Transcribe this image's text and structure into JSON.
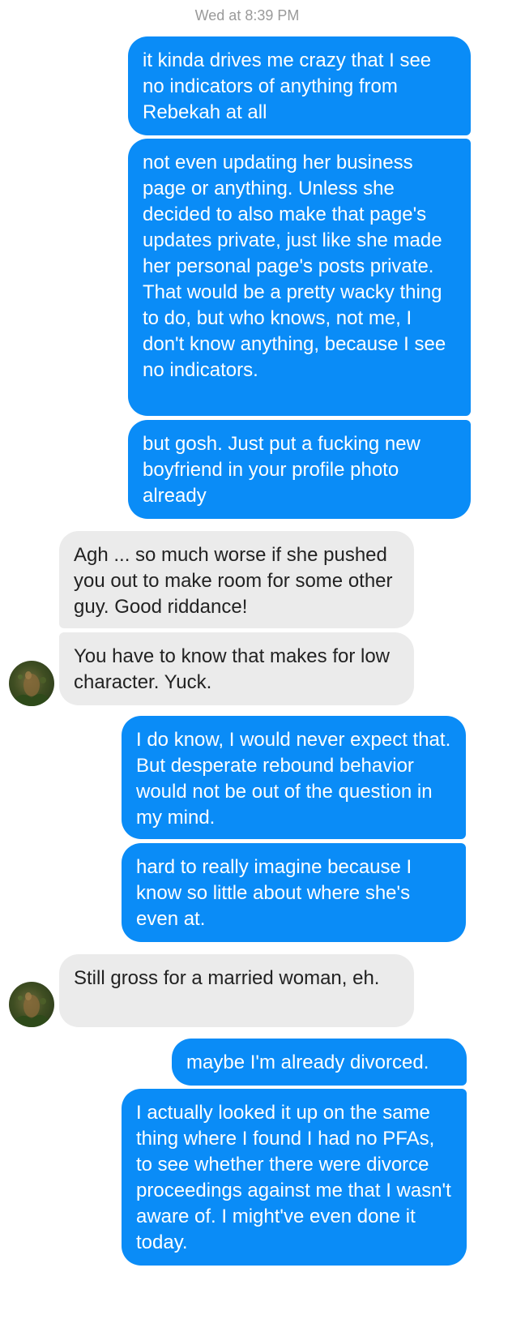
{
  "timestamp": "Wed at 8:39 PM",
  "messages": [
    {
      "direction": "outgoing",
      "text": "it kinda drives me crazy that I see no indicators of anything from Rebekah at all"
    },
    {
      "direction": "outgoing",
      "text": "not even updating her business page or anything. Unless she decided to also make that page's updates private, just like she made her personal page's posts private. That would be a pretty wacky thing to do, but who knows, not me, I don't know anything, because I see no indicators."
    },
    {
      "direction": "outgoing",
      "text": "but gosh. Just put a fucking new boyfriend in your profile photo already"
    },
    {
      "direction": "incoming",
      "text": "Agh ... so much worse if she pushed you out to make room for some other guy. Good riddance!"
    },
    {
      "direction": "incoming",
      "text": "You have to know that makes for low character. Yuck."
    },
    {
      "direction": "outgoing",
      "text": "I do know, I would never expect that. But desperate rebound behavior would not be out of the question in my mind."
    },
    {
      "direction": "outgoing",
      "text": "hard to really imagine because I know so little about where she's even at."
    },
    {
      "direction": "incoming",
      "text": "Still gross for a married woman, eh."
    },
    {
      "direction": "outgoing",
      "text": "maybe I'm already divorced."
    },
    {
      "direction": "outgoing",
      "text": "I actually looked it up on the same thing where I found I had no PFAs, to see whether there were divorce proceedings against me that I wasn't aware of. I might've even done it today."
    }
  ],
  "avatar_icon": "contact-photo-icon",
  "colors": {
    "outgoing_bubble": "#0a8cf7",
    "incoming_bubble": "#ebebeb",
    "timestamp_text": "#9a9a9a"
  }
}
